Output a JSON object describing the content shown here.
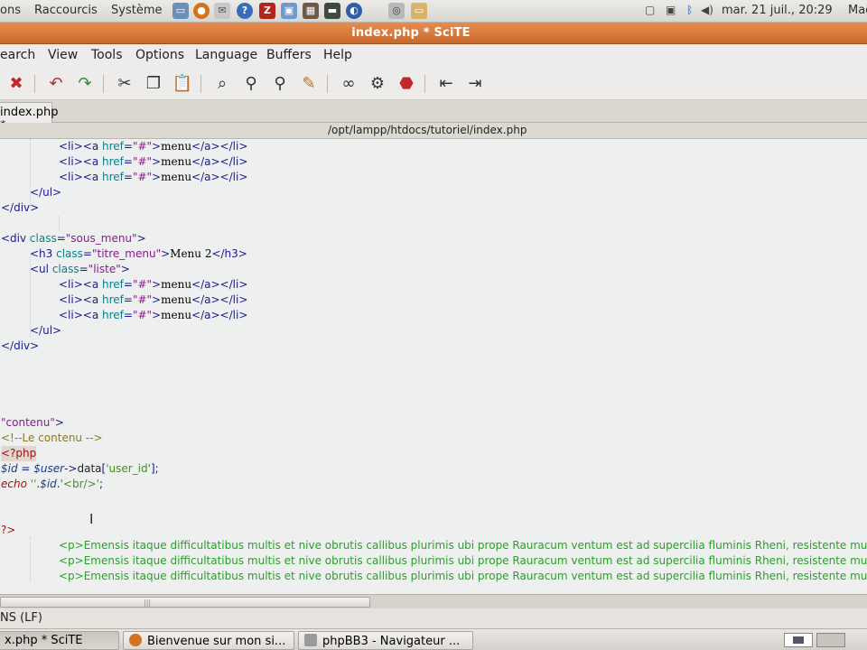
{
  "top_panel": {
    "menus": [
      "ons",
      "Raccourcis",
      "Système"
    ],
    "clock": "mar. 21 juil., 20:29",
    "user": "Mac"
  },
  "window": {
    "title": "index.php * SciTE"
  },
  "menubar": [
    "earch",
    "View",
    "Tools",
    "Options",
    "Language",
    "Buffers",
    "Help"
  ],
  "toolbar": {
    "icons": [
      "close-file-icon",
      "undo-icon",
      "redo-icon",
      "cut-icon",
      "copy-icon",
      "paste-icon",
      "find-icon",
      "find-next-icon",
      "find-in-files-icon",
      "replace-icon",
      "binoculars-icon",
      "compile-icon",
      "stop-icon",
      "previous-file-icon",
      "next-file-icon"
    ]
  },
  "tab": {
    "label": "index.php *"
  },
  "path": "/opt/lampp/htdocs/tutoriel/index.php",
  "code": {
    "menu_item": [
      "<li><a ",
      "href",
      "=",
      "\"#\"",
      ">",
      "menu",
      "</a></li>"
    ],
    "ul_close": "</ul>",
    "div_close": "</div>",
    "div_open": [
      "<div ",
      "class",
      "=",
      "\"sous_menu\"",
      ">"
    ],
    "h3": [
      "<h3 ",
      "class",
      "=",
      "\"titre_menu\"",
      ">",
      "Menu 2",
      "</h3>"
    ],
    "ul_open": [
      "<ul ",
      "class",
      "=",
      "\"liste\"",
      ">"
    ],
    "contenu": [
      "\"contenu\"",
      ">"
    ],
    "comment": "<!--Le contenu -->",
    "php_open": "<?php",
    "php_line1": [
      "$id",
      " = ",
      "$user",
      "->",
      "data",
      "[",
      "'user_id'",
      "];"
    ],
    "php_line2": [
      "echo",
      " ",
      "''",
      ".",
      "$id",
      ".",
      "'<br/>'",
      ";"
    ],
    "php_close": "?>",
    "para": "<p>Emensis itaque difficultatibus multis et nive obrutis callibus plurimis ubi prope Rauracum ventum est ad supercilia fluminis Rheni, resistente mu"
  },
  "statusbar": {
    "text": "NS (LF)"
  },
  "taskbar": [
    {
      "label": "x.php * SciTE"
    },
    {
      "label": "Bienvenue sur mon si..."
    },
    {
      "label": "phpBB3 - Navigateur ..."
    }
  ]
}
